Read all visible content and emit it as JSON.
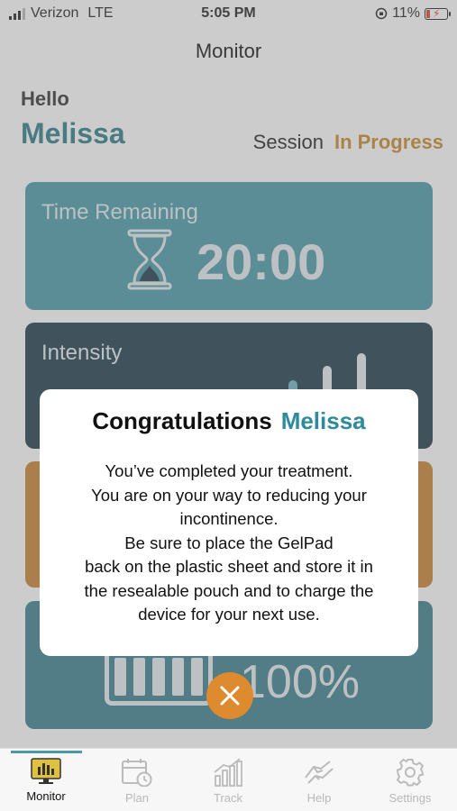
{
  "status_bar": {
    "carrier": "Verizon",
    "network": "LTE",
    "time": "5:05 PM",
    "battery_percent": "11%"
  },
  "nav": {
    "title": "Monitor"
  },
  "greeting": {
    "hello": "Hello",
    "name": "Melissa"
  },
  "session": {
    "label": "Session",
    "status": "In Progress"
  },
  "cards": {
    "time_remaining": {
      "title": "Time Remaining",
      "value": "20:00"
    },
    "intensity": {
      "title": "Intensity"
    },
    "battery": {
      "value": "100%"
    }
  },
  "modal": {
    "title_word": "Congratulations",
    "title_name": "Melissa",
    "lines": [
      "You’ve completed your treatment.",
      "You are on your way to reducing your",
      "incontinence.",
      "Be sure to place the GelPad",
      "back on the plastic sheet and store it in",
      "the resealable pouch and to charge the",
      "device for your next use."
    ]
  },
  "tabs": [
    {
      "label": "Monitor",
      "icon": "monitor-icon",
      "active": true
    },
    {
      "label": "Plan",
      "icon": "calendar-clock-icon",
      "active": false
    },
    {
      "label": "Track",
      "icon": "bar-chart-icon",
      "active": false
    },
    {
      "label": "Help",
      "icon": "handshake-icon",
      "active": false
    },
    {
      "label": "Settings",
      "icon": "gear-icon",
      "active": false
    }
  ],
  "colors": {
    "teal": "#4a9aa9",
    "dark_navy": "#1e3c4c",
    "orange": "#c98331",
    "accent_orange": "#de8a2e",
    "name_teal": "#2e7d8a"
  }
}
